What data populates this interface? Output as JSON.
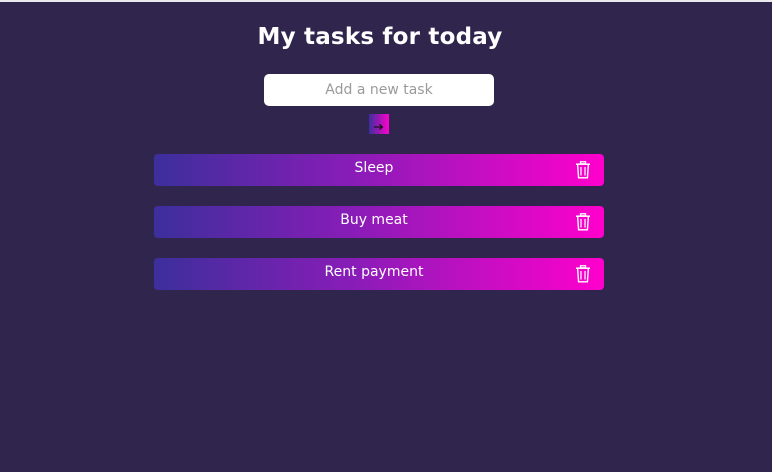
{
  "title": "My tasks for today",
  "input": {
    "placeholder": "Add a new task",
    "value": ""
  },
  "add_button": {
    "icon": "arrow-right-icon"
  },
  "tasks": [
    {
      "label": "Sleep",
      "icon": "trash-icon"
    },
    {
      "label": "Buy meat",
      "icon": "trash-icon"
    },
    {
      "label": "Rent payment",
      "icon": "trash-icon"
    }
  ],
  "colors": {
    "background": "#30264d",
    "gradient_start": "#3c2f9c",
    "gradient_end": "#ff00cc",
    "input_bg": "#ffffff"
  }
}
